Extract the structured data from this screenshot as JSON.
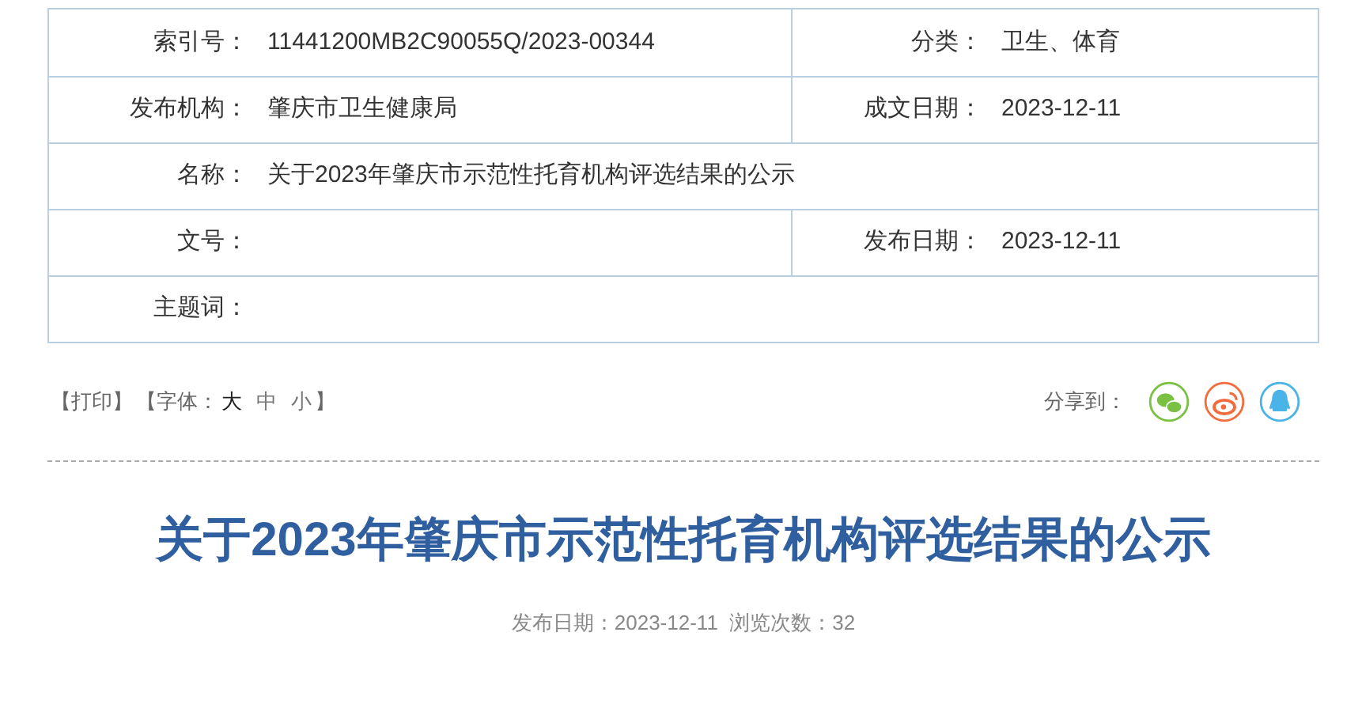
{
  "info_table": {
    "rows": [
      {
        "cells": [
          {
            "label": "索引号：",
            "value": "11441200MB2C90055Q/2023-00344"
          },
          {
            "label": "分类：",
            "value": "卫生、体育"
          }
        ]
      },
      {
        "cells": [
          {
            "label": "发布机构：",
            "value": "肇庆市卫生健康局"
          },
          {
            "label": "成文日期：",
            "value": "2023-12-11"
          }
        ]
      },
      {
        "cells": [
          {
            "label": "名称：",
            "value": "关于2023年肇庆市示范性托育机构评选结果的公示"
          }
        ]
      },
      {
        "cells": [
          {
            "label": "文号："
          },
          {
            "label": "发布日期：",
            "value": "2023-12-11"
          }
        ]
      },
      {
        "cells": [
          {
            "label": "主题词："
          }
        ]
      }
    ]
  },
  "toolbar": {
    "print": "【打印】",
    "font_label": "【字体：",
    "font_sizes": [
      {
        "label": "大",
        "selected": true
      },
      {
        "label": "中",
        "selected": false
      },
      {
        "label": "小",
        "selected": false
      }
    ],
    "font_end": "】",
    "share_label": "分享到：",
    "share": [
      {
        "kind": "wechat",
        "color": "#7ac143"
      },
      {
        "kind": "weibo",
        "color": "#f26d3d"
      },
      {
        "kind": "qq",
        "color": "#4ab3e8"
      }
    ]
  },
  "article": {
    "title": "关于2023年肇庆市示范性托育机构评选结果的公示",
    "meta": [
      {
        "label": "发布日期：",
        "value": "2023-12-11"
      },
      {
        "label": "浏览次数：",
        "value": "32"
      }
    ]
  }
}
